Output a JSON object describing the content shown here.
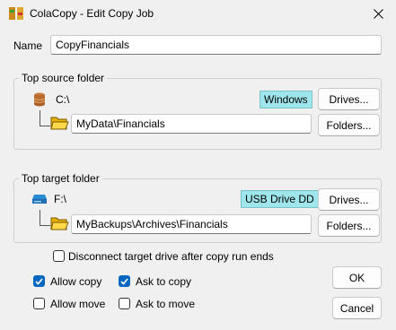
{
  "window": {
    "title": "ColaCopy - Edit Copy Job"
  },
  "name_field": {
    "label": "Name",
    "value": "CopyFinancials"
  },
  "source": {
    "group_title": "Top source folder",
    "drive": "C:\\",
    "drive_icon": "database-drive-icon",
    "badge": "Windows",
    "drives_button": "Drives...",
    "folder": "MyData\\Financials",
    "folders_button": "Folders..."
  },
  "target": {
    "group_title": "Top target folder",
    "drive": "F:\\",
    "drive_icon": "usb-drive-icon",
    "badge": "USB Drive DD",
    "drives_button": "Drives...",
    "folder": "MyBackups\\Archives\\Financials",
    "folders_button": "Folders..."
  },
  "options": {
    "disconnect": {
      "label": "Disconnect target drive after copy run ends",
      "checked": false
    },
    "allow_copy": {
      "label": "Allow copy",
      "checked": true
    },
    "ask_copy": {
      "label": "Ask to copy",
      "checked": true
    },
    "allow_move": {
      "label": "Allow move",
      "checked": false
    },
    "ask_move": {
      "label": "Ask to move",
      "checked": false
    }
  },
  "buttons": {
    "ok": "OK",
    "cancel": "Cancel"
  },
  "colors": {
    "accent": "#0067c0",
    "badge": "#9ee6ec",
    "folder": "#f5c518"
  }
}
